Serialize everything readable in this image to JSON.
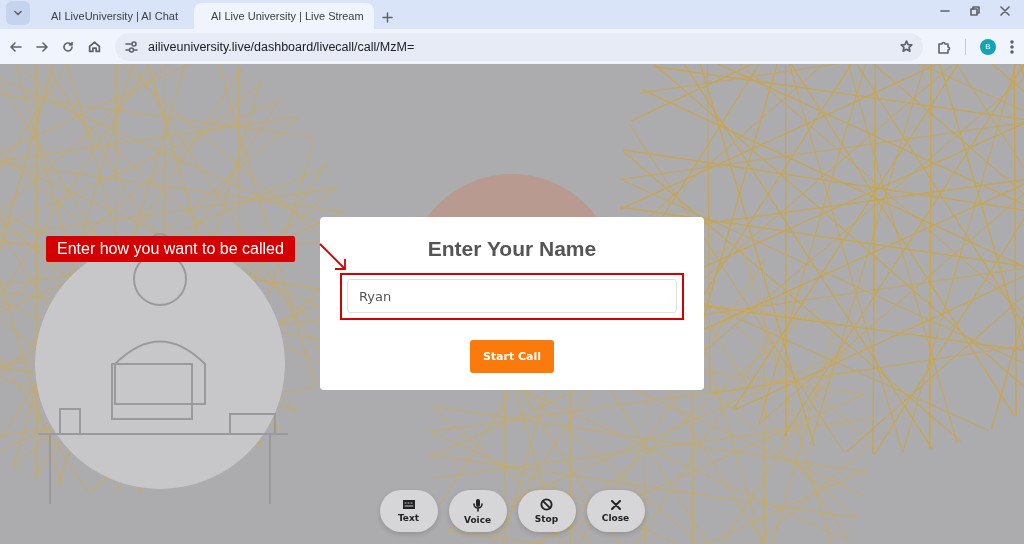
{
  "browser": {
    "tabs": [
      {
        "title": "AI LiveUniversity | AI Chat",
        "selected": false
      },
      {
        "title": "AI Live University | Live Stream",
        "selected": true
      }
    ],
    "url": "ailiveuniversity.live/dashboard/livecall/call/MzM=",
    "profile_initial": "B"
  },
  "dialog": {
    "title": "Enter Your Name",
    "name_field": {
      "value": "Ryan"
    },
    "button": "Start Call"
  },
  "annotation": {
    "label": "Enter how you want to be called"
  },
  "controls": [
    {
      "kind": "text",
      "label": "Text"
    },
    {
      "kind": "voice",
      "label": "Voice"
    },
    {
      "kind": "stop",
      "label": "Stop"
    },
    {
      "kind": "close",
      "label": "Close"
    }
  ]
}
